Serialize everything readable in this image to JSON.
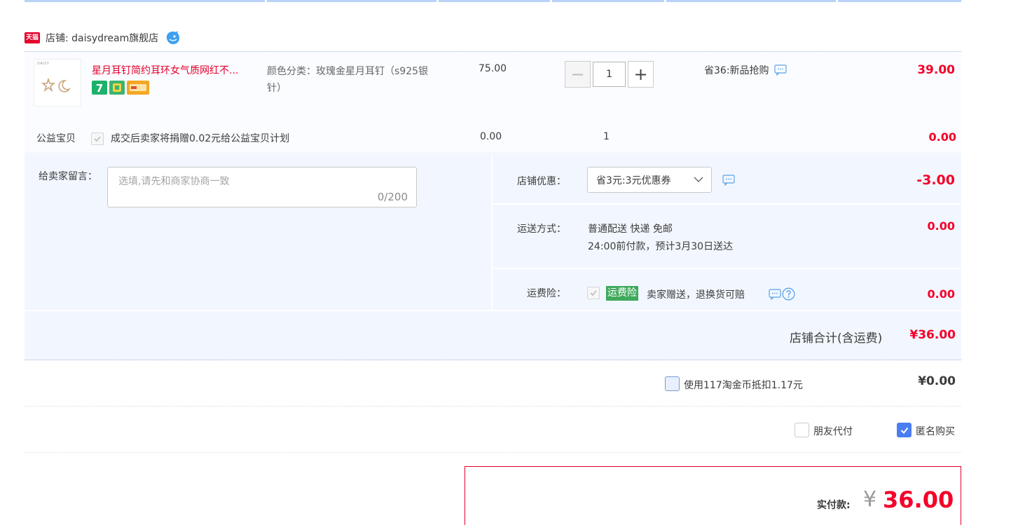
{
  "shop": {
    "badge": "天猫",
    "name": "店铺: daisydream旗舰店"
  },
  "item": {
    "thumb_brand": "DAISY",
    "title": "星月耳钉简约耳环女气质网红不...",
    "sku": "颜色分类：玫瑰金星月耳钉（s925银针）",
    "price": "75.00",
    "quantity": "1",
    "promo": "省36:新品抢购",
    "subtotal": "39.00"
  },
  "charity": {
    "label": "公益宝贝",
    "text": "成交后卖家将捐赠0.02元给公益宝贝计划",
    "price": "0.00",
    "qty": "1",
    "total": "0.00"
  },
  "message": {
    "label": "给卖家留言：",
    "placeholder": "选填,请先和商家协商一致",
    "counter": "0/200"
  },
  "coupon": {
    "label": "店铺优惠：",
    "selected": "省3元:3元优惠券",
    "value": "-3.00"
  },
  "shipping": {
    "label": "运送方式：",
    "line1": "普通配送 快递 免邮",
    "line2": "24:00前付款，预计3月30日送达",
    "fee": "0.00"
  },
  "insurance": {
    "label": "运费险：",
    "tag": "运费险",
    "text": "卖家赠送，退换货可赔",
    "fee": "0.00"
  },
  "shop_total": {
    "label": "店铺合计(含运费)",
    "value": "¥36.00"
  },
  "coins": {
    "text": "使用117淘金币抵扣1.17元",
    "value": "¥0.00"
  },
  "options": {
    "friend_pay": "朋友代付",
    "anonymous": "匿名购买"
  },
  "payment": {
    "label": "实付款:",
    "yen": "¥",
    "value": "36.00"
  },
  "colors": {
    "accent": "#f40029",
    "panel": "#f2f7ff",
    "checked": "#4a7df2",
    "insurance_tag": "#3fa95c"
  },
  "icons": [
    "tmall-badge-icon",
    "wangwang-icon",
    "chat-icon",
    "help-icon",
    "chevron-down-icon",
    "check-icon"
  ]
}
